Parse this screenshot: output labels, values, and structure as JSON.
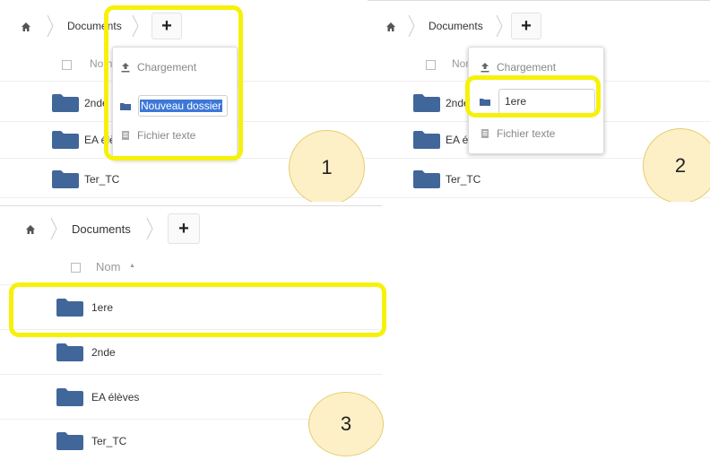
{
  "breadcrumb": {
    "folder": "Documents",
    "add_symbol": "+"
  },
  "step1": {
    "breadcrumb_label": "Documents",
    "column_header": "Nom",
    "files": [
      "2nde",
      "EA élèves",
      "Ter_TC"
    ],
    "menu": {
      "upload": "Chargement",
      "new_folder_value": "Nouveau dossier",
      "text_file": "Fichier texte"
    },
    "step_number": "1"
  },
  "step2": {
    "breadcrumb_label": "Documents",
    "column_header": "Nom",
    "files": [
      "2nde",
      "EA élèves",
      "Ter_TC"
    ],
    "menu": {
      "upload": "Chargement",
      "new_folder_value": "1ere",
      "text_file": "Fichier texte"
    },
    "step_number": "2"
  },
  "step3": {
    "breadcrumb_label": "Documents",
    "column_header": "Nom",
    "sort_indicator": "▲",
    "files": [
      "1ere",
      "2nde",
      "EA élèves",
      "Ter_TC"
    ],
    "step_number": "3"
  },
  "colors": {
    "highlight": "#f7f10a",
    "folder": "#41669a",
    "selection": "#3d78d8",
    "circle_fill": "#fdf0c7"
  },
  "icons": {
    "home": "home-icon",
    "folder": "folder-icon",
    "upload": "upload-icon",
    "text_file": "text-file-icon",
    "add": "plus-icon"
  }
}
